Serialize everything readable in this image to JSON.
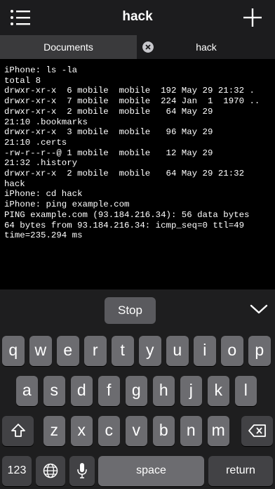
{
  "header": {
    "title": "hack",
    "menu_icon": "list-icon",
    "add_icon": "plus-icon"
  },
  "tabs": [
    {
      "label": "Documents"
    },
    {
      "label": "hack"
    }
  ],
  "terminal": {
    "lines": [
      "iPhone: ls -la",
      "total 8",
      "drwxr-xr-x  6 mobile  mobile  192 May 29 21:32 .",
      "drwxr-xr-x  7 mobile  mobile  224 Jan  1  1970 ..",
      "drwxr-xr-x  2 mobile  mobile   64 May 29",
      "21:10 .bookmarks",
      "drwxr-xr-x  3 mobile  mobile   96 May 29",
      "21:10 .certs",
      "-rw-r--r--@ 1 mobile  mobile   12 May 29",
      "21:32 .history",
      "drwxr-xr-x  2 mobile  mobile   64 May 29 21:32",
      "hack",
      "iPhone: cd hack",
      "iPhone: ping example.com",
      "PING example.com (93.184.216.34): 56 data bytes",
      "64 bytes from 93.184.216.34: icmp_seq=0 ttl=49",
      "time=235.294 ms"
    ]
  },
  "toolbar": {
    "stop_label": "Stop",
    "dismiss_icon": "chevron-down-icon"
  },
  "keyboard": {
    "row1": [
      "q",
      "w",
      "e",
      "r",
      "t",
      "y",
      "u",
      "i",
      "o",
      "p"
    ],
    "row2": [
      "a",
      "s",
      "d",
      "f",
      "g",
      "h",
      "j",
      "k",
      "l"
    ],
    "row3": [
      "z",
      "x",
      "c",
      "v",
      "b",
      "n",
      "m"
    ],
    "numbers_label": "123",
    "space_label": "space",
    "return_label": "return"
  }
}
